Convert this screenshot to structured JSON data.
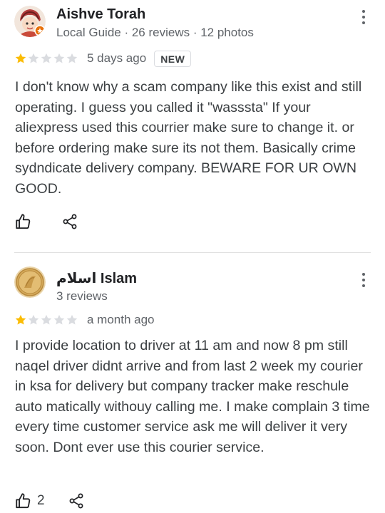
{
  "reviews": [
    {
      "author": "Aishve Torah",
      "meta": "Local Guide · 26 reviews · 12 photos",
      "rating": 1,
      "max_rating": 5,
      "date": "5 days ago",
      "badge": "NEW",
      "text": "I don't know why a scam company like this exist and still operating. I guess you called it \"wasssta\" If your aliexpress used this courrier make sure to change it. or before ordering make sure its not them. Basically crime sydndicate delivery company. BEWARE FOR UR OWN GOOD.",
      "likes": ""
    },
    {
      "author": "اسلام Islam",
      "meta": "3 reviews",
      "rating": 1,
      "max_rating": 5,
      "date": "a month ago",
      "text": "I provide location to driver at 11 am and now 8 pm still naqel driver didnt arrive and from last 2 week my courier in ksa for delivery but company tracker make reschule auto matically withouy calling me. I make complain 3 time every time customer service ask me will deliver it very soon. Dont ever use this courier service.",
      "likes": "2"
    }
  ],
  "colors": {
    "star_filled": "#fbbc04",
    "star_empty": "#dadce0",
    "text_primary": "#202124",
    "text_secondary": "#5f6368",
    "divider": "#e0e0e0"
  },
  "icons": [
    "more-vert-icon",
    "thumb-up-icon",
    "share-icon",
    "star-icon"
  ]
}
